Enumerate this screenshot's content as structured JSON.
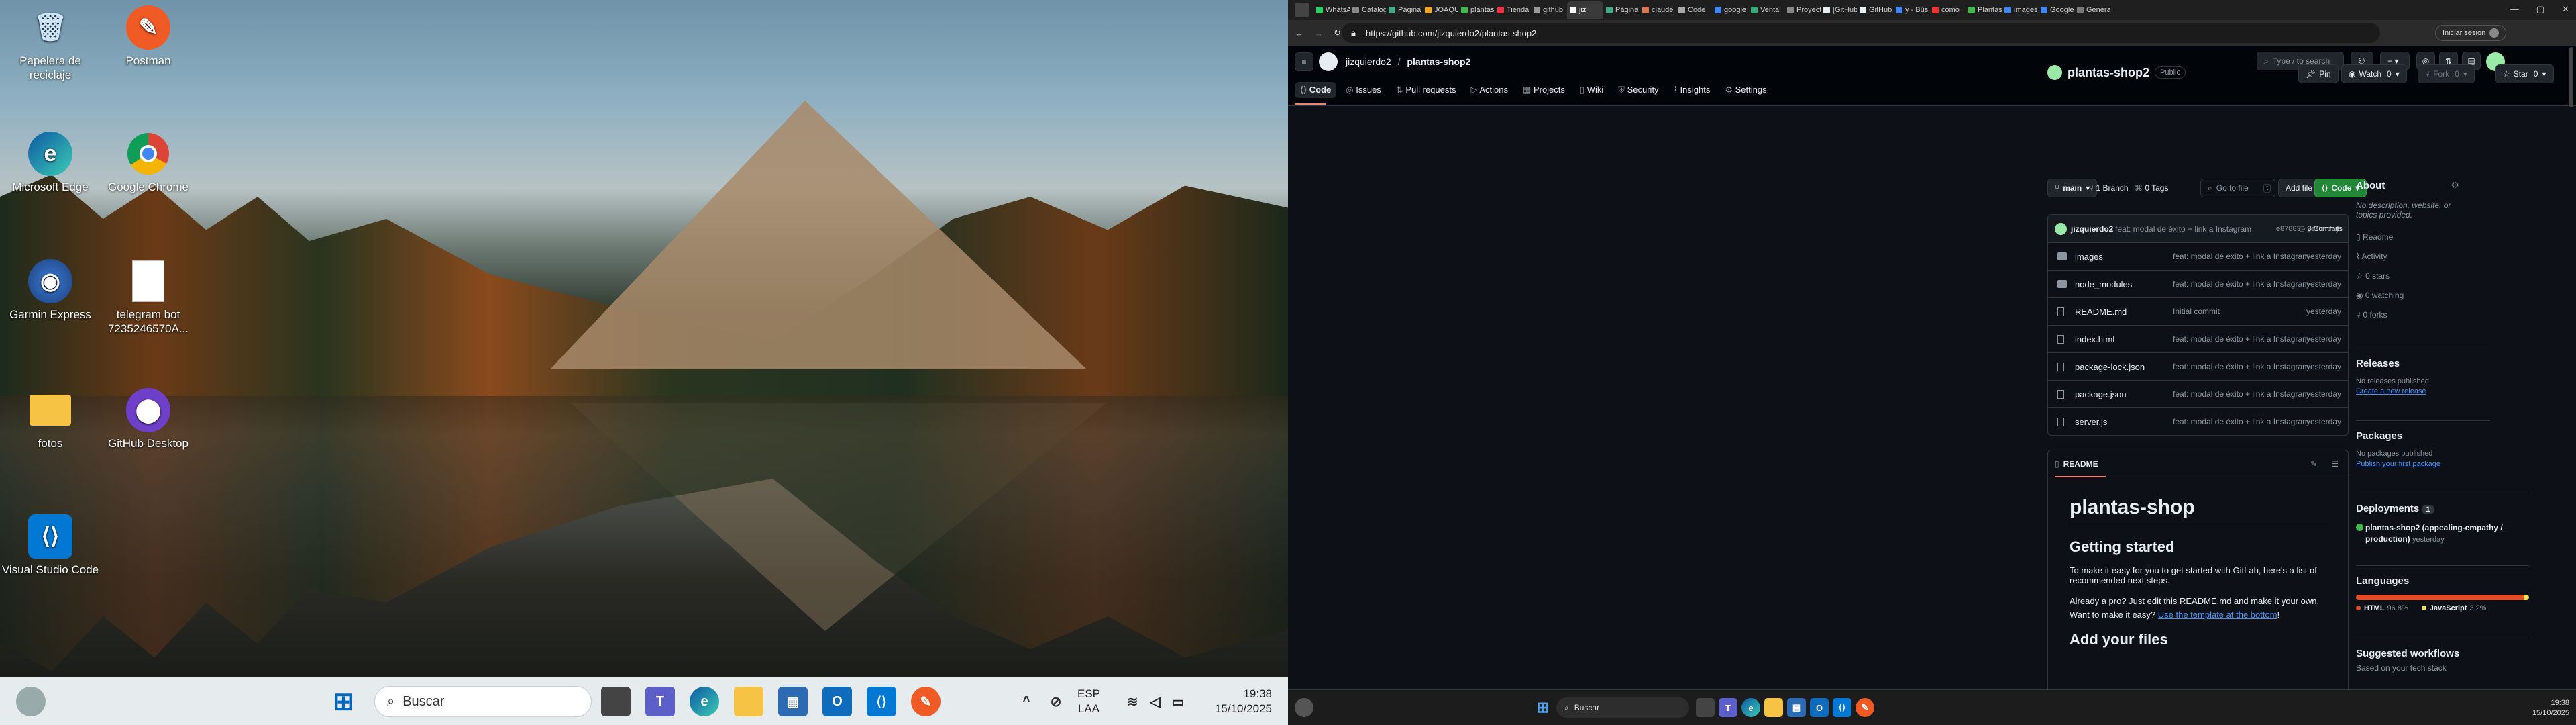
{
  "desktop": {
    "icons": [
      {
        "label": "Papelera de reciclaje",
        "icon": "recycle-bin-icon"
      },
      {
        "label": "Postman",
        "icon": "postman-icon"
      },
      {
        "label": "Microsoft Edge",
        "icon": "edge-icon"
      },
      {
        "label": "Google Chrome",
        "icon": "chrome-icon"
      },
      {
        "label": "Garmin Express",
        "icon": "garmin-icon"
      },
      {
        "label": "telegram bot 7235246570A...",
        "icon": "document-icon"
      },
      {
        "label": "fotos",
        "icon": "folder-icon"
      },
      {
        "label": "GitHub Desktop",
        "icon": "github-desktop-icon"
      },
      {
        "label": "Visual Studio Code",
        "icon": "vscode-icon"
      }
    ]
  },
  "taskbar1": {
    "search": "Buscar",
    "lang1": "ESP",
    "lang2": "LAA",
    "time": "19:38",
    "date": "15/10/2025"
  },
  "browser": {
    "tabs": [
      "WhatsApp",
      "Catálogo",
      "Página",
      "JOAQU",
      "plantas",
      "Tienda",
      "github",
      "jiz",
      "Página",
      "claude",
      "Code",
      "google",
      "Venta",
      "Proyect",
      "[GitHub]",
      "GitHub",
      "y - Bús",
      "como",
      "Plantas",
      "images",
      "Google",
      "Genera"
    ],
    "url": "https://github.com/jizquierdo2/plantas-shop2",
    "signin": "Iniciar sesión"
  },
  "gh": {
    "owner": "jizquierdo2",
    "sep": "/",
    "repo": "plantas-shop2",
    "search_placeholder": "Type / to search",
    "nav": [
      "Code",
      "Issues",
      "Pull requests",
      "Actions",
      "Projects",
      "Wiki",
      "Security",
      "Insights",
      "Settings"
    ],
    "repo_title": "plantas-shop2",
    "visibility": "Public",
    "pin": "Pin",
    "watch": "Watch",
    "watch_count": "0",
    "fork": "Fork",
    "fork_count": "0",
    "star": "Star",
    "star_count": "0",
    "branch": "main",
    "branches": "1 Branch",
    "tags": "0 Tags",
    "goto": "Go to file",
    "goto_key": "t",
    "add_file": "Add file",
    "code_btn": "Code",
    "commit_author": "jizquierdo2",
    "commit_msg": "feat: modal de éxito + link a Instagram",
    "commit_meta": "e87883 · yesterday",
    "commits": "3 Commits",
    "files": [
      {
        "name": "images",
        "type": "folder",
        "msg": "feat: modal de éxito + link a Instagram",
        "date": "yesterday"
      },
      {
        "name": "node_modules",
        "type": "folder",
        "msg": "feat: modal de éxito + link a Instagram",
        "date": "yesterday"
      },
      {
        "name": "README.md",
        "type": "file",
        "msg": "Initial commit",
        "date": "yesterday"
      },
      {
        "name": "index.html",
        "type": "file",
        "msg": "feat: modal de éxito + link a Instagram",
        "date": "yesterday"
      },
      {
        "name": "package-lock.json",
        "type": "file",
        "msg": "feat: modal de éxito + link a Instagram",
        "date": "yesterday"
      },
      {
        "name": "package.json",
        "type": "file",
        "msg": "feat: modal de éxito + link a Instagram",
        "date": "yesterday"
      },
      {
        "name": "server.js",
        "type": "file",
        "msg": "feat: modal de éxito + link a Instagram",
        "date": "yesterday"
      }
    ],
    "readme_tab": "README",
    "readme": {
      "h1": "plantas-shop",
      "h2": "Getting started",
      "p1": "To make it easy for you to get started with GitLab, here's a list of recommended next steps.",
      "p2a": "Already a pro? Just edit this README.md and make it your own. Want to make it easy?",
      "p2link": "Use the template at the bottom",
      "p2end": "!",
      "h2b": "Add your files"
    },
    "about": {
      "title": "About",
      "desc": "No description, website, or topics provided.",
      "items": [
        "Readme",
        "Activity",
        "0 stars",
        "0 watching",
        "0 forks"
      ]
    },
    "releases": {
      "title": "Releases",
      "text": "No releases published",
      "link": "Create a new release"
    },
    "packages": {
      "title": "Packages",
      "text": "No packages published",
      "link": "Publish your first package"
    },
    "deployments": {
      "title": "Deployments",
      "count": "1",
      "name": "plantas-shop2 (appealing-empathy / production)",
      "time": "yesterday"
    },
    "languages": {
      "title": "Languages",
      "items": [
        {
          "name": "HTML",
          "pct": "96.8%",
          "color": "#e34c26",
          "value": 96.8
        },
        {
          "name": "JavaScript",
          "pct": "3.2%",
          "color": "#f1e05a",
          "value": 3.2
        }
      ]
    },
    "workflows": {
      "title": "Suggested workflows",
      "sub": "Based on your tech stack"
    }
  },
  "taskbar2": {
    "search": "Buscar",
    "time": "19:38",
    "date": "15/10/2025"
  }
}
